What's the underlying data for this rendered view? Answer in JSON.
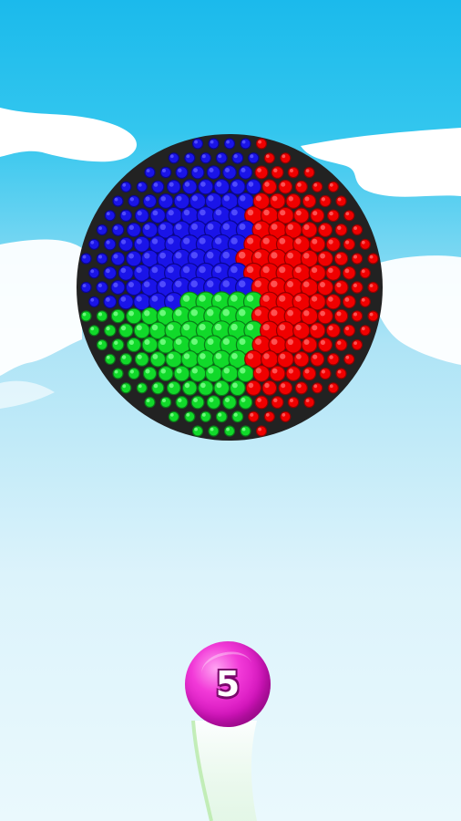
{
  "shooter": {
    "count": "5",
    "color": "#e81ccd"
  },
  "target_sphere": {
    "colors": {
      "blue": "#1a14e8",
      "red": "#f00000",
      "green": "#11d92a"
    }
  },
  "palette": {
    "sky_top": "#18b8e8",
    "sky_bottom": "#e8f8fd",
    "cloud": "#ffffff"
  }
}
